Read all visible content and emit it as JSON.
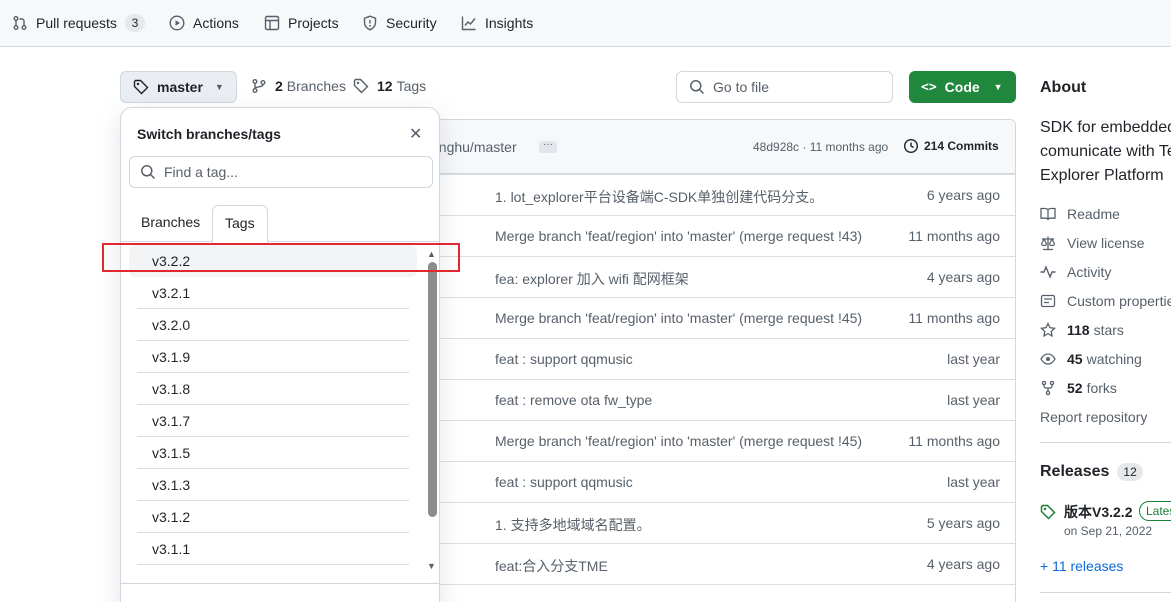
{
  "nav": {
    "pull_requests": "Pull requests",
    "pull_requests_count": "3",
    "actions": "Actions",
    "projects": "Projects",
    "security": "Security",
    "insights": "Insights"
  },
  "branch_bar": {
    "current_branch": "master",
    "branches_count": "2",
    "branches_label": "Branches",
    "tags_count": "12",
    "tags_label": "Tags",
    "goto_placeholder": "Go to file",
    "code_label": "Code"
  },
  "file_header": {
    "user": "enghu/master",
    "sha_time": "48d928c · 11 months ago",
    "commits": "214 Commits"
  },
  "commits": [
    {
      "msg": "1. lot_explorer平台设备端C-SDK单独创建代码分支。",
      "date": "6 years ago"
    },
    {
      "msg": "Merge branch 'feat/region' into 'master' (merge request !43)",
      "date": "11 months ago"
    },
    {
      "msg": "fea: explorer 加入 wifi 配网框架",
      "date": "4 years ago"
    },
    {
      "msg": "Merge branch 'feat/region' into 'master' (merge request !45)",
      "date": "11 months ago"
    },
    {
      "msg": "feat : support qqmusic",
      "date": "last year"
    },
    {
      "msg": "feat : remove ota fw_type",
      "date": "last year"
    },
    {
      "msg": "Merge branch 'feat/region' into 'master' (merge request !45)",
      "date": "11 months ago"
    },
    {
      "msg": "feat : support qqmusic",
      "date": "last year"
    },
    {
      "msg": "1. 支持多地域域名配置。",
      "date": "5 years ago"
    },
    {
      "msg": "feat:合入分支TME",
      "date": "4 years ago"
    }
  ],
  "dropdown": {
    "title": "Switch branches/tags",
    "search_placeholder": "Find a tag...",
    "tab_branches": "Branches",
    "tab_tags": "Tags",
    "tags": [
      "v3.2.2",
      "v3.2.1",
      "v3.2.0",
      "v3.1.9",
      "v3.1.8",
      "v3.1.7",
      "v3.1.5",
      "v3.1.3",
      "v3.1.2",
      "v3.1.1"
    ],
    "selected_tag": "v3.2.2"
  },
  "about": {
    "title": "About",
    "desc_lines": [
      "SDK for embedded",
      "comunicate with Te",
      "Explorer Platform"
    ],
    "readme": "Readme",
    "license": "View license",
    "activity": "Activity",
    "custom_properties": "Custom properties",
    "stars_count": "118",
    "stars_label": "stars",
    "watching_count": "45",
    "watching_label": "watching",
    "forks_count": "52",
    "forks_label": "forks",
    "report": "Report repository"
  },
  "releases": {
    "title": "Releases",
    "count": "12",
    "latest_name": "版本V3.2.2",
    "latest_badge": "Latest",
    "latest_date": "on Sep 21, 2022",
    "more": "+ 11 releases"
  },
  "colors": {
    "code_button": "#1f883d",
    "highlight_box": "#e0292f",
    "link": "#0969da"
  }
}
